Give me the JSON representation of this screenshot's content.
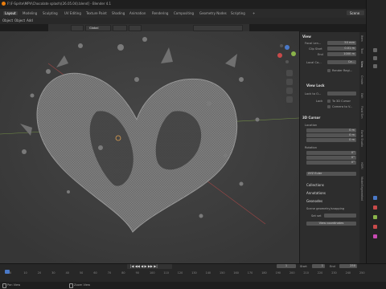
{
  "window": {
    "title": "F:\\F-Sprite\\MPV\\Chocolate splash\\(26.05.04).blend] - Blender 4.1"
  },
  "workspace_tabs": [
    "Layout",
    "Modeling",
    "Sculpting",
    "UV Editing",
    "Texture Paint",
    "Shading",
    "Animation",
    "Rendering",
    "Compositing",
    "Geometry Nodes",
    "Scripting"
  ],
  "scene": "Scene",
  "menu": [
    "Object",
    "Object",
    "Add",
    "Object"
  ],
  "header3d": {
    "orientation": "Global"
  },
  "npanel": {
    "view_title": "View",
    "focal_length_label": "Focal Len...",
    "focal_length_value": "50 mm",
    "clip_start_label": "Clip Start",
    "clip_start_value": "0.01 m",
    "end_label": "End",
    "end_value": "1000 m",
    "local_camera_label": "Local Ca...",
    "local_camera_value": "Ca...",
    "render_region_label": "Render Regi...",
    "view_lock_title": "View Lock",
    "lock_to_object_label": "Lock to O...",
    "lock_label": "Lock",
    "to_3d_cursor_label": "To 3D Cursor",
    "camera_to_view_label": "Camera to V...",
    "cursor_title": "3D Cursor",
    "location_label": "Location",
    "x_label": "X",
    "x_value": "0 m",
    "y_label": "Y",
    "y_value": "0 m",
    "z_label": "Z",
    "z_value": "0 m",
    "rotation_label": "Rotation",
    "rx_value": "0°",
    "ry_value": "0°",
    "rz_value": "0°",
    "rotation_mode": "XYZ Euler",
    "collections_title": "Collections",
    "annotations_title": "Annotations",
    "geonodes_title": "Geonodes",
    "geonodes_sub": "Scene geometry/snapping",
    "set_label": "Set set",
    "view_coords_label": "View coordinates"
  },
  "npanel_tabs": [
    "Item",
    "Tool",
    "View",
    "Create",
    "Edit",
    "Fluid Sim",
    "Earth Studio",
    "HDRI",
    "ModelSegmented"
  ],
  "timeline": {
    "ticks": [
      "0",
      "10",
      "20",
      "30",
      "40",
      "50",
      "60",
      "70",
      "80",
      "90",
      "100",
      "110",
      "120",
      "130",
      "140",
      "150",
      "160",
      "170",
      "180",
      "190",
      "200",
      "210",
      "220",
      "230",
      "240",
      "250"
    ],
    "current_frame": "1",
    "start_label": "Start",
    "start_value": "1",
    "end_label": "End",
    "end_value": "250"
  },
  "status": {
    "left": "Pan View",
    "mid": "Zoom View"
  },
  "colors": {
    "accent": "#4a79c8",
    "x_axis": "#c84a4a",
    "y_axis": "#8ab34a",
    "z_axis": "#4a79c8",
    "bg_viewport": "#3d3d3d"
  }
}
